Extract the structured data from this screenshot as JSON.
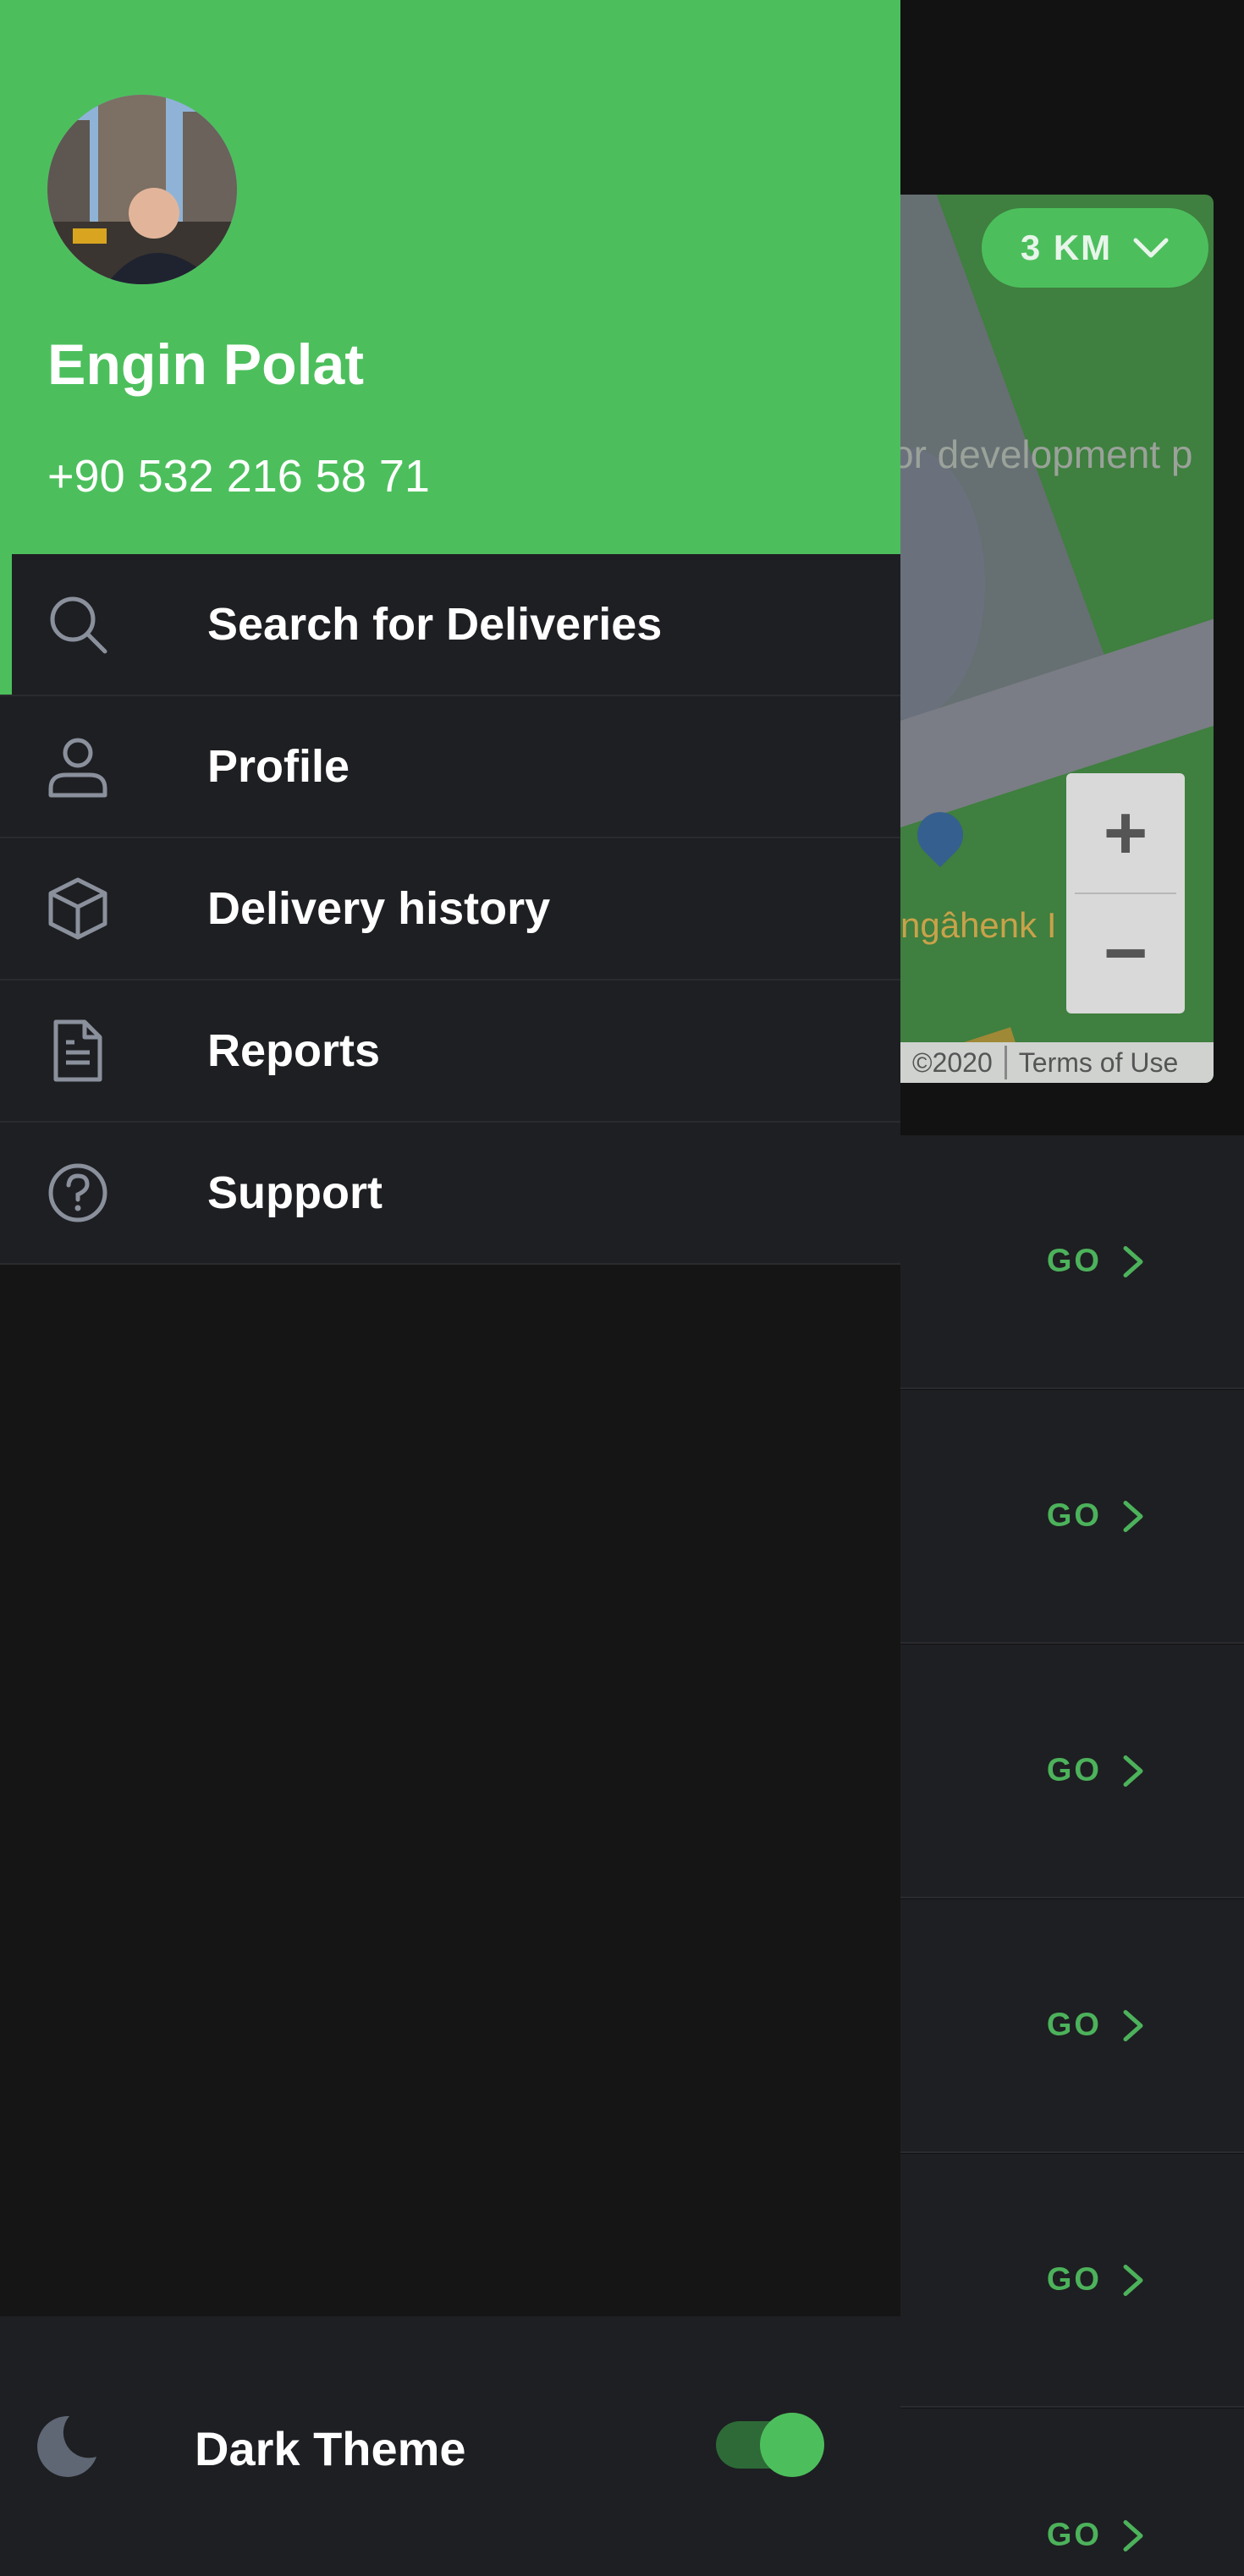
{
  "background": {
    "filter": {
      "distance_label": "3 KM"
    },
    "map": {
      "label_development": "or development p",
      "label_place": "ngâhenk I",
      "attribution_year": "©2020",
      "terms_link": "Terms of Use"
    },
    "list": {
      "go_label": "GO",
      "rows": [
        "GO",
        "GO",
        "GO",
        "GO",
        "GO",
        "GO"
      ]
    }
  },
  "drawer": {
    "user": {
      "name": "Engin Polat",
      "phone": "+90 532 216 58 71"
    },
    "menu": [
      {
        "label": "Search for Deliveries",
        "icon": "search-icon",
        "active": true
      },
      {
        "label": "Profile",
        "icon": "user-icon",
        "active": false
      },
      {
        "label": "Delivery history",
        "icon": "box-icon",
        "active": false
      },
      {
        "label": "Reports",
        "icon": "document-icon",
        "active": false
      },
      {
        "label": "Support",
        "icon": "help-icon",
        "active": false
      }
    ],
    "theme": {
      "label": "Dark Theme",
      "enabled": true
    }
  },
  "colors": {
    "accent": "#4cbf5c",
    "drawer_bg": "#151516",
    "menu_bg": "#1e1f22",
    "icon_gray": "#8a909c"
  }
}
